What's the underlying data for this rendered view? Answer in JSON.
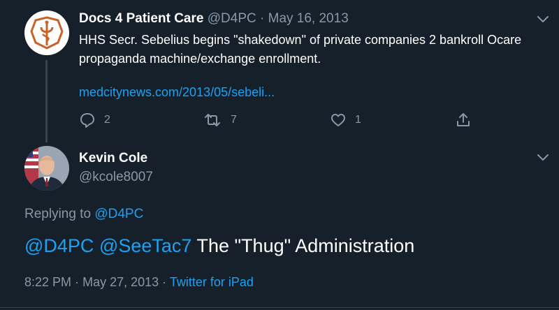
{
  "parent_tweet": {
    "display_name": "Docs 4 Patient Care",
    "handle": "@D4PC",
    "separator": "·",
    "date": "May 16, 2013",
    "text": "HHS Secr. Sebelius begins \"shakedown\" of private companies 2 bankroll Ocare propaganda machine/exchange enrollment.",
    "link": "medcitynews.com/2013/05/sebeli...",
    "reply_count": "2",
    "retweet_count": "7",
    "like_count": "1"
  },
  "reply_tweet": {
    "display_name": "Kevin Cole",
    "handle": "@kcole8007",
    "replying_label": "Replying to",
    "replying_to": "@D4PC",
    "mention_1": "@D4PC",
    "mention_2": "@SeeTac7",
    "text": "The \"Thug\" Administration",
    "time": "8:22 PM",
    "separator": "·",
    "date": "May 27, 2013",
    "source": "Twitter for iPad"
  },
  "icons": {
    "parent_avatar": "caduceus-logo",
    "more": "chevron-down-icon",
    "reply": "reply-bubble-icon",
    "retweet": "retweet-icon",
    "like": "heart-icon",
    "share": "share-icon"
  },
  "colors": {
    "background": "#15202b",
    "text_primary": "#ffffff",
    "text_secondary": "#8899a6",
    "link": "#1da1f2",
    "logo_accent": "#d2691e"
  }
}
